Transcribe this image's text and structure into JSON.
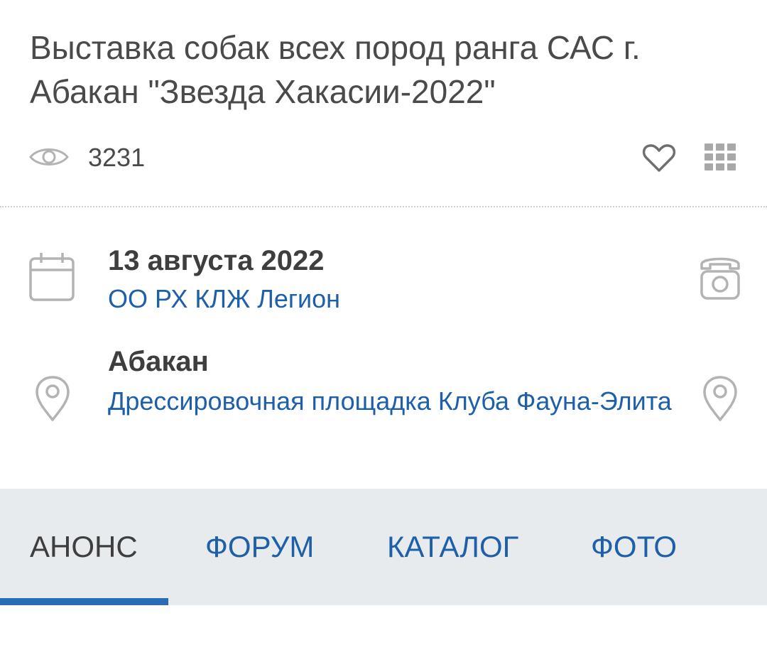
{
  "event": {
    "title": "Выставка собак всех пород ранга САС г. Абакан \"Звезда Хакасии-2022\"",
    "views": "3231",
    "date": "13 августа 2022",
    "organizer": "ОО РХ КЛЖ Легион",
    "city": "Абакан",
    "venue": "Дрессировочная площадка Клуба Фауна-Элита"
  },
  "icons": {
    "views": "eye-icon",
    "favorite": "heart-icon",
    "menu": "grid-icon",
    "date": "calendar-icon",
    "contact": "phone-icon",
    "location": "map-pin-icon"
  },
  "tabs": [
    {
      "label": "АНОНС",
      "active": true
    },
    {
      "label": "ФОРУМ",
      "active": false
    },
    {
      "label": "КАТАЛОГ",
      "active": false
    },
    {
      "label": "ФОТО",
      "active": false
    }
  ],
  "colors": {
    "text": "#4a4a4a",
    "link": "#1d5fa8",
    "icon": "#b3b3b3",
    "tabs_background": "#e8ebee",
    "tab_indicator": "#2a6cb3"
  }
}
